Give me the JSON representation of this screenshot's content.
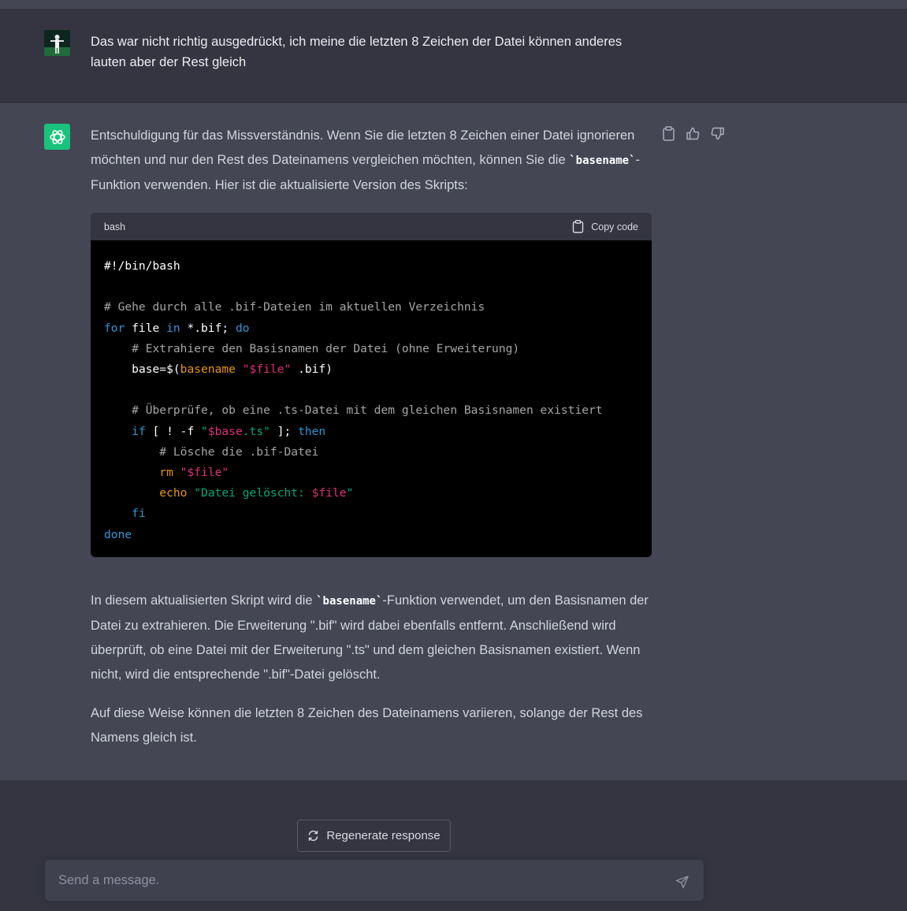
{
  "user_message": {
    "text": "Das war nicht richtig ausgedrückt, ich meine die letzten 8 Zeichen der Datei können anderes lauten aber der Rest gleich"
  },
  "assistant_message": {
    "intro": {
      "part1": "Entschuldigung für das Missverständnis. Wenn Sie die letzten 8 Zeichen einer Datei ignorieren möchten und nur den Rest des Dateinamens vergleichen möchten, können Sie die ",
      "code": "`basename`",
      "part2": "-Funktion verwenden. Hier ist die aktualisierte Version des Skripts:"
    },
    "code_block": {
      "language": "bash",
      "copy_label": "Copy code",
      "lines": {
        "l1": "#!/bin/bash",
        "l3": "# Gehe durch alle .bif-Dateien im aktuellen Verzeichnis",
        "l4_for": "for",
        "l4_file": " file ",
        "l4_in": "in",
        "l4_glob": " *.bif; ",
        "l4_do": "do",
        "l5": "# Extrahiere den Basisnamen der Datei (ohne Erweiterung)",
        "l6_a": "base=$(",
        "l6_cmd": "basename",
        "l6_sp": " ",
        "l6_str": "\"$file\"",
        "l6_b": " .bif)",
        "l8": "# Überprüfe, ob eine .ts-Datei mit dem gleichen Basisnamen existiert",
        "l9_if": "if",
        "l9_a": " [ ! -f ",
        "l9_str1": "\"",
        "l9_var": "$base",
        "l9_str2": ".ts\"",
        "l9_b": " ]; ",
        "l9_then": "then",
        "l10": "# Lösche die .bif-Datei",
        "l11_cmd": "rm",
        "l11_str": "\"$file\"",
        "l12_cmd": "echo",
        "l12_str": "\"Datei gelöscht: ",
        "l12_var": "$file",
        "l12_end": "\"",
        "l13": "fi",
        "l14": "done"
      }
    },
    "para2": {
      "part1": "In diesem aktualisierten Skript wird die ",
      "code": "`basename`",
      "part2": "-Funktion verwendet, um den Basisnamen der Datei zu extrahieren. Die Erweiterung \".bif\" wird dabei ebenfalls entfernt. Anschließend wird überprüft, ob eine Datei mit der Erweiterung \".ts\" und dem gleichen Basisnamen existiert. Wenn nicht, wird die entsprechende \".bif\"-Datei gelöscht."
    },
    "para3": "Auf diese Weise können die letzten 8 Zeichen des Dateinamens variieren, solange der Rest des Namens gleich ist.",
    "icons": [
      "clipboard-icon",
      "thumbs-up-icon",
      "thumbs-down-icon"
    ]
  },
  "composer": {
    "regenerate_label": "Regenerate response",
    "placeholder": "Send a message."
  },
  "colors": {
    "background": "#343541",
    "assistant_bg": "#444654",
    "brand_green": "#19c37d",
    "code_bg": "#000000"
  }
}
